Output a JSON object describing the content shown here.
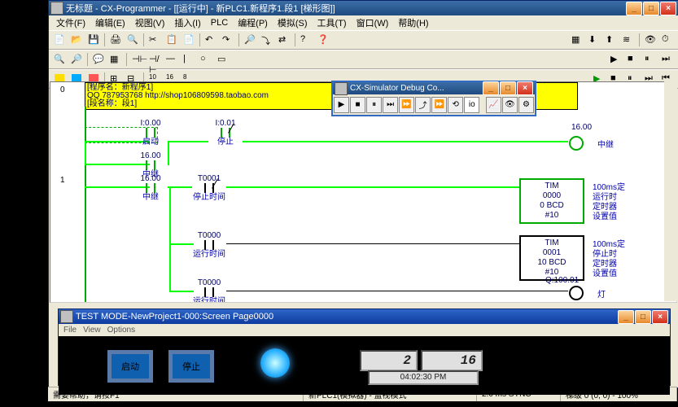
{
  "main": {
    "title": "无标题 - CX-Programmer - [[运行中] - 新PLC1.新程序1.段1 [梯形图]]",
    "menus": [
      "文件(F)",
      "编辑(E)",
      "视图(V)",
      "插入(I)",
      "PLC",
      "编程(P)",
      "模拟(S)",
      "工具(T)",
      "窗口(W)",
      "帮助(H)"
    ]
  },
  "yellow": {
    "l1": "[程序名：新程序1]",
    "l2": "QQ 787953768 http://shop106809598.taobao.com",
    "l3": "[段名称：段1]"
  },
  "rungs": {
    "r0": "0",
    "r1": "1"
  },
  "contacts": {
    "c1": {
      "addr": "I:0.00",
      "cmt": "启动"
    },
    "c2": {
      "addr": "I:0.01",
      "cmt": "停止"
    },
    "c3": {
      "addr": "16.00",
      "cmt": "中继"
    },
    "c4": {
      "addr": "16.00",
      "cmt": "中继"
    },
    "c5": {
      "addr": "T0001",
      "cmt": "停止时间"
    },
    "c6": {
      "addr": "T0000",
      "cmt": "运行时间"
    },
    "c7": {
      "addr": "T0000",
      "cmt": "运行时间"
    }
  },
  "coils": {
    "o1": {
      "addr": "16.00",
      "cmt": "中继"
    },
    "o2": {
      "addr": "Q:100.01",
      "cmt": "灯"
    }
  },
  "tim": {
    "t1": {
      "op": "TIM",
      "n": "0000",
      "v": "0 BCD",
      "p": "#10"
    },
    "t2": {
      "op": "TIM",
      "n": "0001",
      "v": "10 BCD",
      "p": "#10"
    }
  },
  "side": {
    "a": "100ms定",
    "b": "运行时",
    "c": "定时器",
    "d": "设置值",
    "e": "100ms定",
    "f": "停止时",
    "g": "定时器",
    "h": "设置值"
  },
  "sim": {
    "title": "CX-Simulator Debug Co..."
  },
  "test": {
    "title": "TEST MODE-NewProject1-000:Screen Page0000",
    "menus": [
      "File",
      "View",
      "Options"
    ],
    "btn1": "启动",
    "btn2": "停止",
    "seg1": "2",
    "seg2": "16",
    "clock": "04:02:30 PM"
  },
  "status": {
    "l": "需要帮助，请按F1",
    "m": "新PLC1(模拟器) - 监视模式",
    "r1": "2.0 ms SYNC",
    "r2": "梯级 0 (0, 0) - 100%"
  }
}
